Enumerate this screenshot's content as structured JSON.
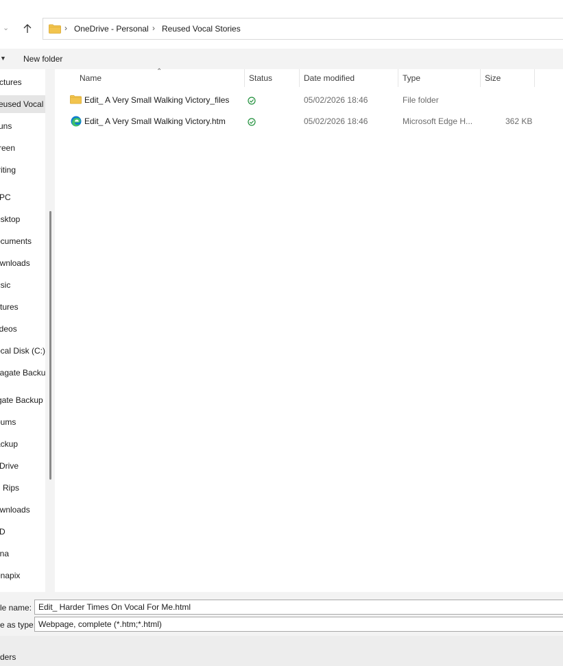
{
  "address_bar": {
    "crumbs": [
      "OneDrive - Personal",
      "Reused  Vocal Stories"
    ]
  },
  "command_bar": {
    "new_folder_label": "New folder"
  },
  "nav_pane": {
    "items": [
      {
        "label": "ctures"
      },
      {
        "label": "eused  Vocal S"
      },
      {
        "label": "uns"
      },
      {
        "label": "reen"
      },
      {
        "label": "riting"
      },
      {
        "label": "PC"
      },
      {
        "label": "esktop"
      },
      {
        "label": "ocuments"
      },
      {
        "label": "ownloads"
      },
      {
        "label": "usic"
      },
      {
        "label": "ctures"
      },
      {
        "label": "ideos"
      },
      {
        "label": "ocal Disk (C:)"
      },
      {
        "label": "eagate Backup"
      },
      {
        "label": "gate Backup I"
      },
      {
        "label": "bums"
      },
      {
        "label": "ackup"
      },
      {
        "label": "Drive"
      },
      {
        "label": "Rips"
      },
      {
        "label": "ownloads"
      },
      {
        "label": "D"
      },
      {
        "label": "ina"
      },
      {
        "label": "enapix"
      }
    ]
  },
  "file_list": {
    "columns": {
      "name": "Name",
      "status": "Status",
      "date": "Date modified",
      "type": "Type",
      "size": "Size"
    },
    "rows": [
      {
        "name": "Edit_ A Very Small Walking Victory_files",
        "icon": "folder-icon",
        "status": "synced-icon",
        "date": "05/02/2026 18:46",
        "type": "File folder",
        "size": ""
      },
      {
        "name": "Edit_ A Very Small Walking Victory.htm",
        "icon": "edge-icon",
        "status": "synced-icon",
        "date": "05/02/2026 18:46",
        "type": "Microsoft Edge H...",
        "size": "362 KB"
      }
    ]
  },
  "save_panel": {
    "file_name_label": "le name:",
    "file_name_value": "Edit_ Harder Times On Vocal For Me.html",
    "save_type_label": "e as type:",
    "save_type_value": "Webpage, complete (*.htm;*.html)",
    "folders_label": "ders"
  },
  "colors": {
    "accent_green": "#1f8f3a",
    "folder_yellow": "#f2c44e"
  }
}
